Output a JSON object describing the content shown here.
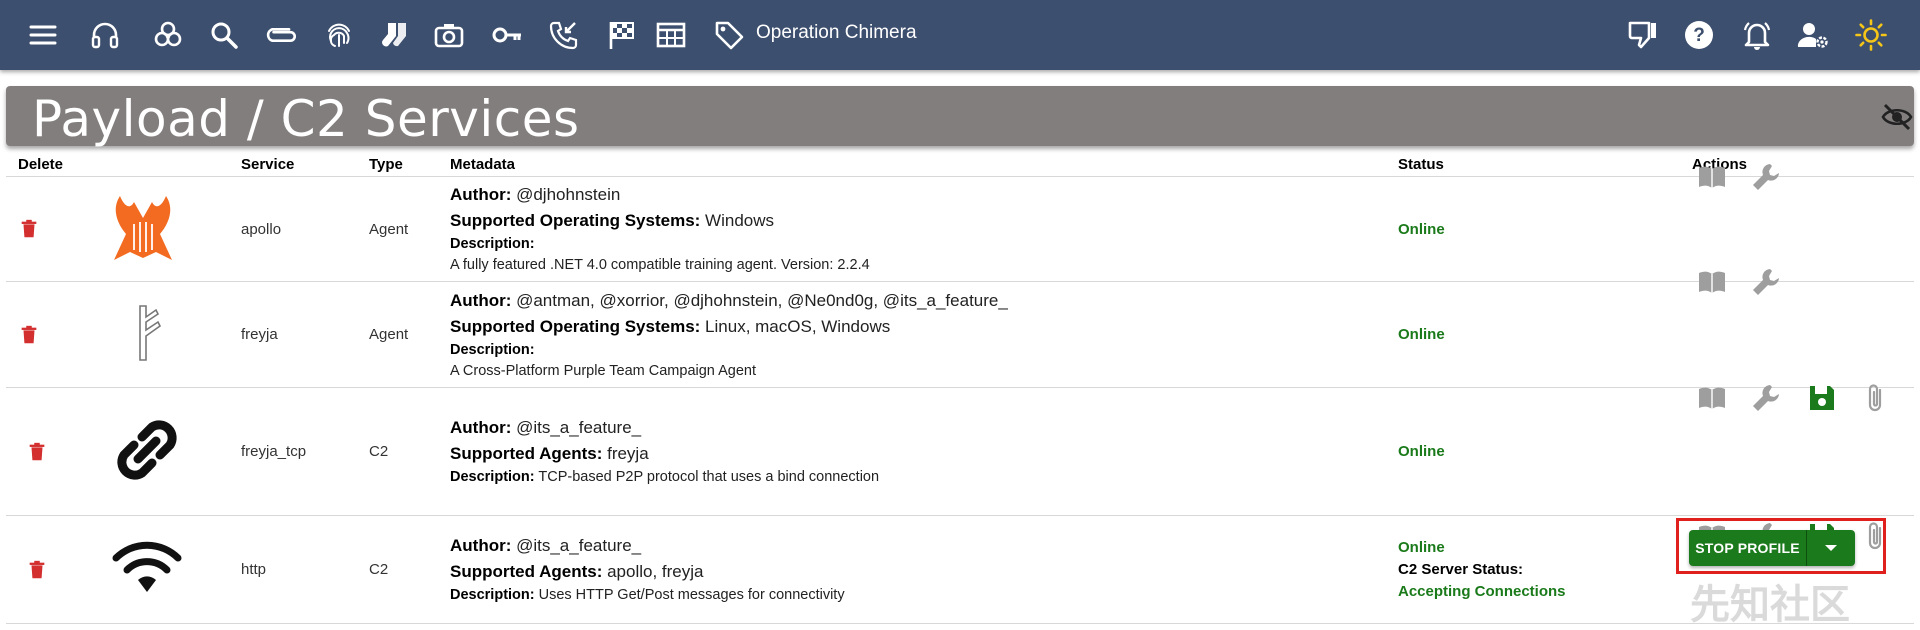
{
  "app": {
    "operation_name": "Operation Chimera"
  },
  "toolbar": {
    "left_icons": [
      "menu-icon",
      "headset-icon",
      "biohazard-icon",
      "search-icon",
      "paperclip-icon",
      "fingerprint-icon",
      "socks-icon",
      "camera-icon",
      "key-icon",
      "phone-callback-icon",
      "checkered-flag-icon",
      "table-icon",
      "tag-icon"
    ],
    "right_icons": [
      "thumbs-down-icon",
      "help-icon",
      "alarm-bell-icon",
      "user-settings-icon",
      "sun-icon"
    ]
  },
  "page": {
    "title": "Payload / C2 Services"
  },
  "table": {
    "headers": {
      "delete": "Delete",
      "service": "Service",
      "type": "Type",
      "metadata": "Metadata",
      "status": "Status",
      "actions": "Actions"
    },
    "rows": [
      {
        "service": "apollo",
        "type": "Agent",
        "icon": "apollo-lyre-icon",
        "author_label": "Author:",
        "author": " @djhohnstein",
        "second_label": "Supported Operating Systems:",
        "second": " Windows",
        "desc_label": "Description:",
        "desc": "A fully featured .NET 4.0 compatible training agent. Version: 2.2.4",
        "status": "Online"
      },
      {
        "service": "freyja",
        "type": "Agent",
        "icon": "freyja-rune-icon",
        "author_label": "Author:",
        "author": " @antman, @xorrior, @djhohnstein, @Ne0nd0g, @its_a_feature_",
        "second_label": "Supported Operating Systems:",
        "second": " Linux, macOS, Windows",
        "desc_label": "Description:",
        "desc": "A Cross-Platform Purple Team Campaign Agent",
        "status": "Online"
      },
      {
        "service": "freyja_tcp",
        "type": "C2",
        "icon": "chain-link-icon",
        "author_label": "Author:",
        "author": " @its_a_feature_",
        "second_label": "Supported Agents:",
        "second": " freyja",
        "desc_label": "Description:",
        "desc": " TCP-based P2P protocol that uses a bind connection",
        "status": "Online"
      },
      {
        "service": "http",
        "type": "C2",
        "icon": "wifi-icon",
        "author_label": "Author:",
        "author": " @its_a_feature_",
        "second_label": "Supported Agents:",
        "second": " apollo, freyja",
        "desc_label": "Description:",
        "desc": " Uses HTTP Get/Post messages for connectivity",
        "status": "Online",
        "c2_status_label": "C2 Server Status:",
        "c2_status": "Accepting Connections",
        "stop_label": "STOP PROFILE"
      }
    ]
  },
  "colors": {
    "appbar": "#3d4f6e",
    "banner": "#837e7e",
    "online": "#1a7a1a",
    "trash": "#d32f2f",
    "apollo": "#f26b21",
    "stop_button": "#1b7a1b",
    "highlight": "#e0201c",
    "sun": "#f5c518"
  },
  "watermark": "先知社区"
}
